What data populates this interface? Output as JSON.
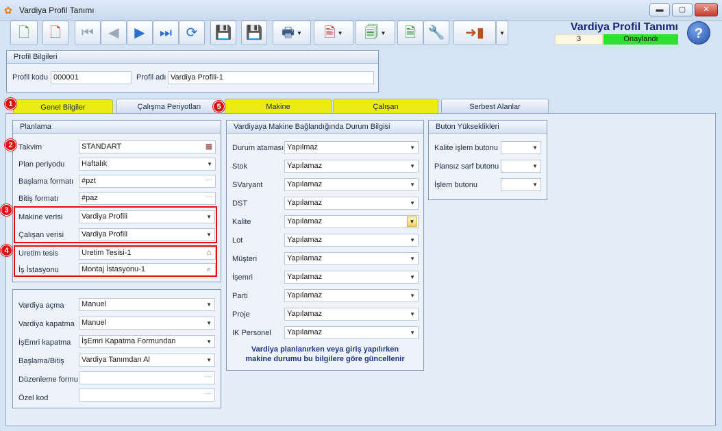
{
  "window": {
    "title": "Vardiya Profil Tanımı",
    "buttons": {
      "minimize": "▬",
      "maximize": "▢",
      "close": "✕"
    }
  },
  "header": {
    "title": "Vardiya Profil Tanımı",
    "number": "3",
    "status": "Onaylandı",
    "status_color": "#33dd33"
  },
  "toolbar": {
    "icons": [
      "new-icon",
      "delete-icon",
      "first-icon",
      "prev-icon",
      "next-icon",
      "last-icon",
      "refresh-icon",
      "save-icon",
      "cancel-icon",
      "print-icon",
      "pdf-icon",
      "export-icon",
      "import-icon",
      "tools-icon",
      "exit-icon",
      "help-icon"
    ]
  },
  "profil": {
    "group_title": "Profil Bilgileri",
    "kod_label": "Profil kodu",
    "kod_value": "000001",
    "ad_label": "Profil adı",
    "ad_value": "Vardiya Profili-1"
  },
  "tabs": [
    {
      "label": "Genel Bilgiler",
      "badge": "1"
    },
    {
      "label": "Çalışma Periyotları"
    },
    {
      "label": "Makine",
      "badge": "5"
    },
    {
      "label": "Çalışan"
    },
    {
      "label": "Serbest Alanlar"
    }
  ],
  "planlama": {
    "group_title": "Planlama",
    "fields": [
      {
        "label": "Takvim",
        "value": "STANDART",
        "badge": "2"
      },
      {
        "label": "Plan periyodu",
        "value": "Haftalık"
      },
      {
        "label": "Başlama formatı",
        "value": "#pzt"
      },
      {
        "label": "Bitiş formatı",
        "value": "#paz"
      },
      {
        "label": "Makine verisi",
        "value": "Vardiya Profili",
        "badge": "3"
      },
      {
        "label": "Çalışan verisi",
        "value": "Vardiya Profili"
      },
      {
        "label": "Uretim tesis",
        "value": "Uretim Tesisi-1",
        "badge": "4"
      },
      {
        "label": "İş İstasyonu",
        "value": "Montaj İstasyonu-1"
      }
    ]
  },
  "vardiya": {
    "fields": [
      {
        "label": "Vardiya açma",
        "value": "Manuel"
      },
      {
        "label": "Vardiya kapatma",
        "value": "Manuel"
      },
      {
        "label": "İşEmri kapatma",
        "value": "İşEmri Kapatma Formundan"
      },
      {
        "label": "Başlama/Bitiş",
        "value": "Vardiya Tanımdan Al"
      },
      {
        "label": "Düzenleme formu",
        "value": ""
      },
      {
        "label": "Özel kod",
        "value": ""
      }
    ]
  },
  "makine_durum": {
    "group_title": "Vardiyaya Makine Bağlandığında Durum Bilgisi",
    "fields": [
      {
        "label": "Durum ataması",
        "value": "Yapılmaz"
      },
      {
        "label": "Stok",
        "value": "Yapılamaz"
      },
      {
        "label": "SVaryant",
        "value": "Yapılamaz"
      },
      {
        "label": "DST",
        "value": "Yapılamaz"
      },
      {
        "label": "Kalite",
        "value": "Yapılamaz"
      },
      {
        "label": "Lot",
        "value": "Yapılamaz"
      },
      {
        "label": "Müşteri",
        "value": "Yapılamaz"
      },
      {
        "label": "İşemri",
        "value": "Yapılamaz"
      },
      {
        "label": "Parti",
        "value": "Yapılamaz"
      },
      {
        "label": "Proje",
        "value": "Yapılamaz"
      },
      {
        "label": "IK Personel",
        "value": "Yapılamaz"
      }
    ],
    "note_line1": "Vardiya planlanırken veya giriş yapılırken",
    "note_line2": "makine durumu bu bilgilere göre güncellenir"
  },
  "buton": {
    "group_title": "Buton Yükseklikleri",
    "fields": [
      {
        "label": "Kalite işlem butonu",
        "value": ""
      },
      {
        "label": "Plansız sarf butonu",
        "value": ""
      },
      {
        "label": "İşlem butonu",
        "value": ""
      }
    ]
  }
}
